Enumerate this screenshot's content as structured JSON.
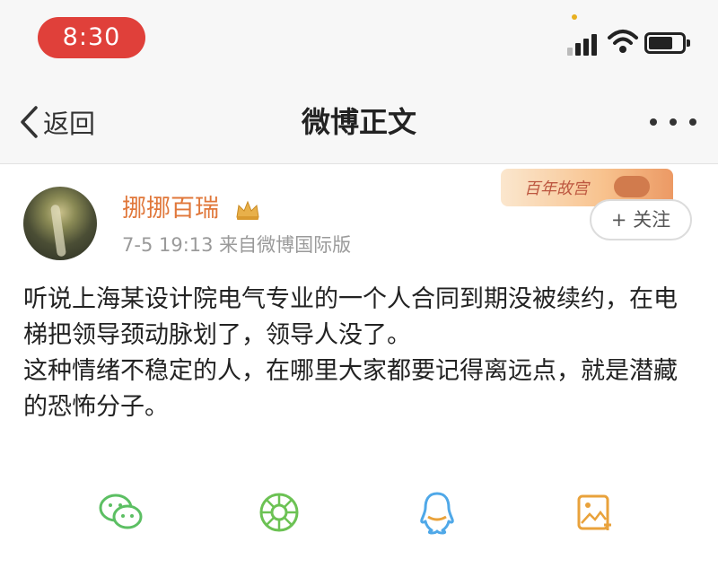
{
  "status_bar": {
    "time": "8:30"
  },
  "nav": {
    "back_label": "返回",
    "title": "微博正文"
  },
  "post": {
    "username": "挪挪百瑞",
    "meta": "7-5 19:13  来自微博国际版",
    "follow_label": "+ 关注",
    "ad_text": "百年故宫",
    "body": [
      "听说上海某设计院电气专业的一个人合同到期没被续约，在电梯把领导颈动脉划了，领导人没了。",
      "这种情绪不稳定的人，在哪里大家都要记得离远点，就是潜藏的恐怖分子。"
    ]
  },
  "share": {
    "items": [
      "wechat-icon",
      "moments-icon",
      "qq-icon",
      "picture-icon"
    ],
    "colors": {
      "wechat": "#5cbf63",
      "moments": "#6cc254",
      "qq": "#4fa8e8",
      "picture": "#e9a23b"
    }
  },
  "colors": {
    "time_pill": "#e0403a",
    "username": "#e0773a",
    "meta": "#9a9a9a"
  }
}
